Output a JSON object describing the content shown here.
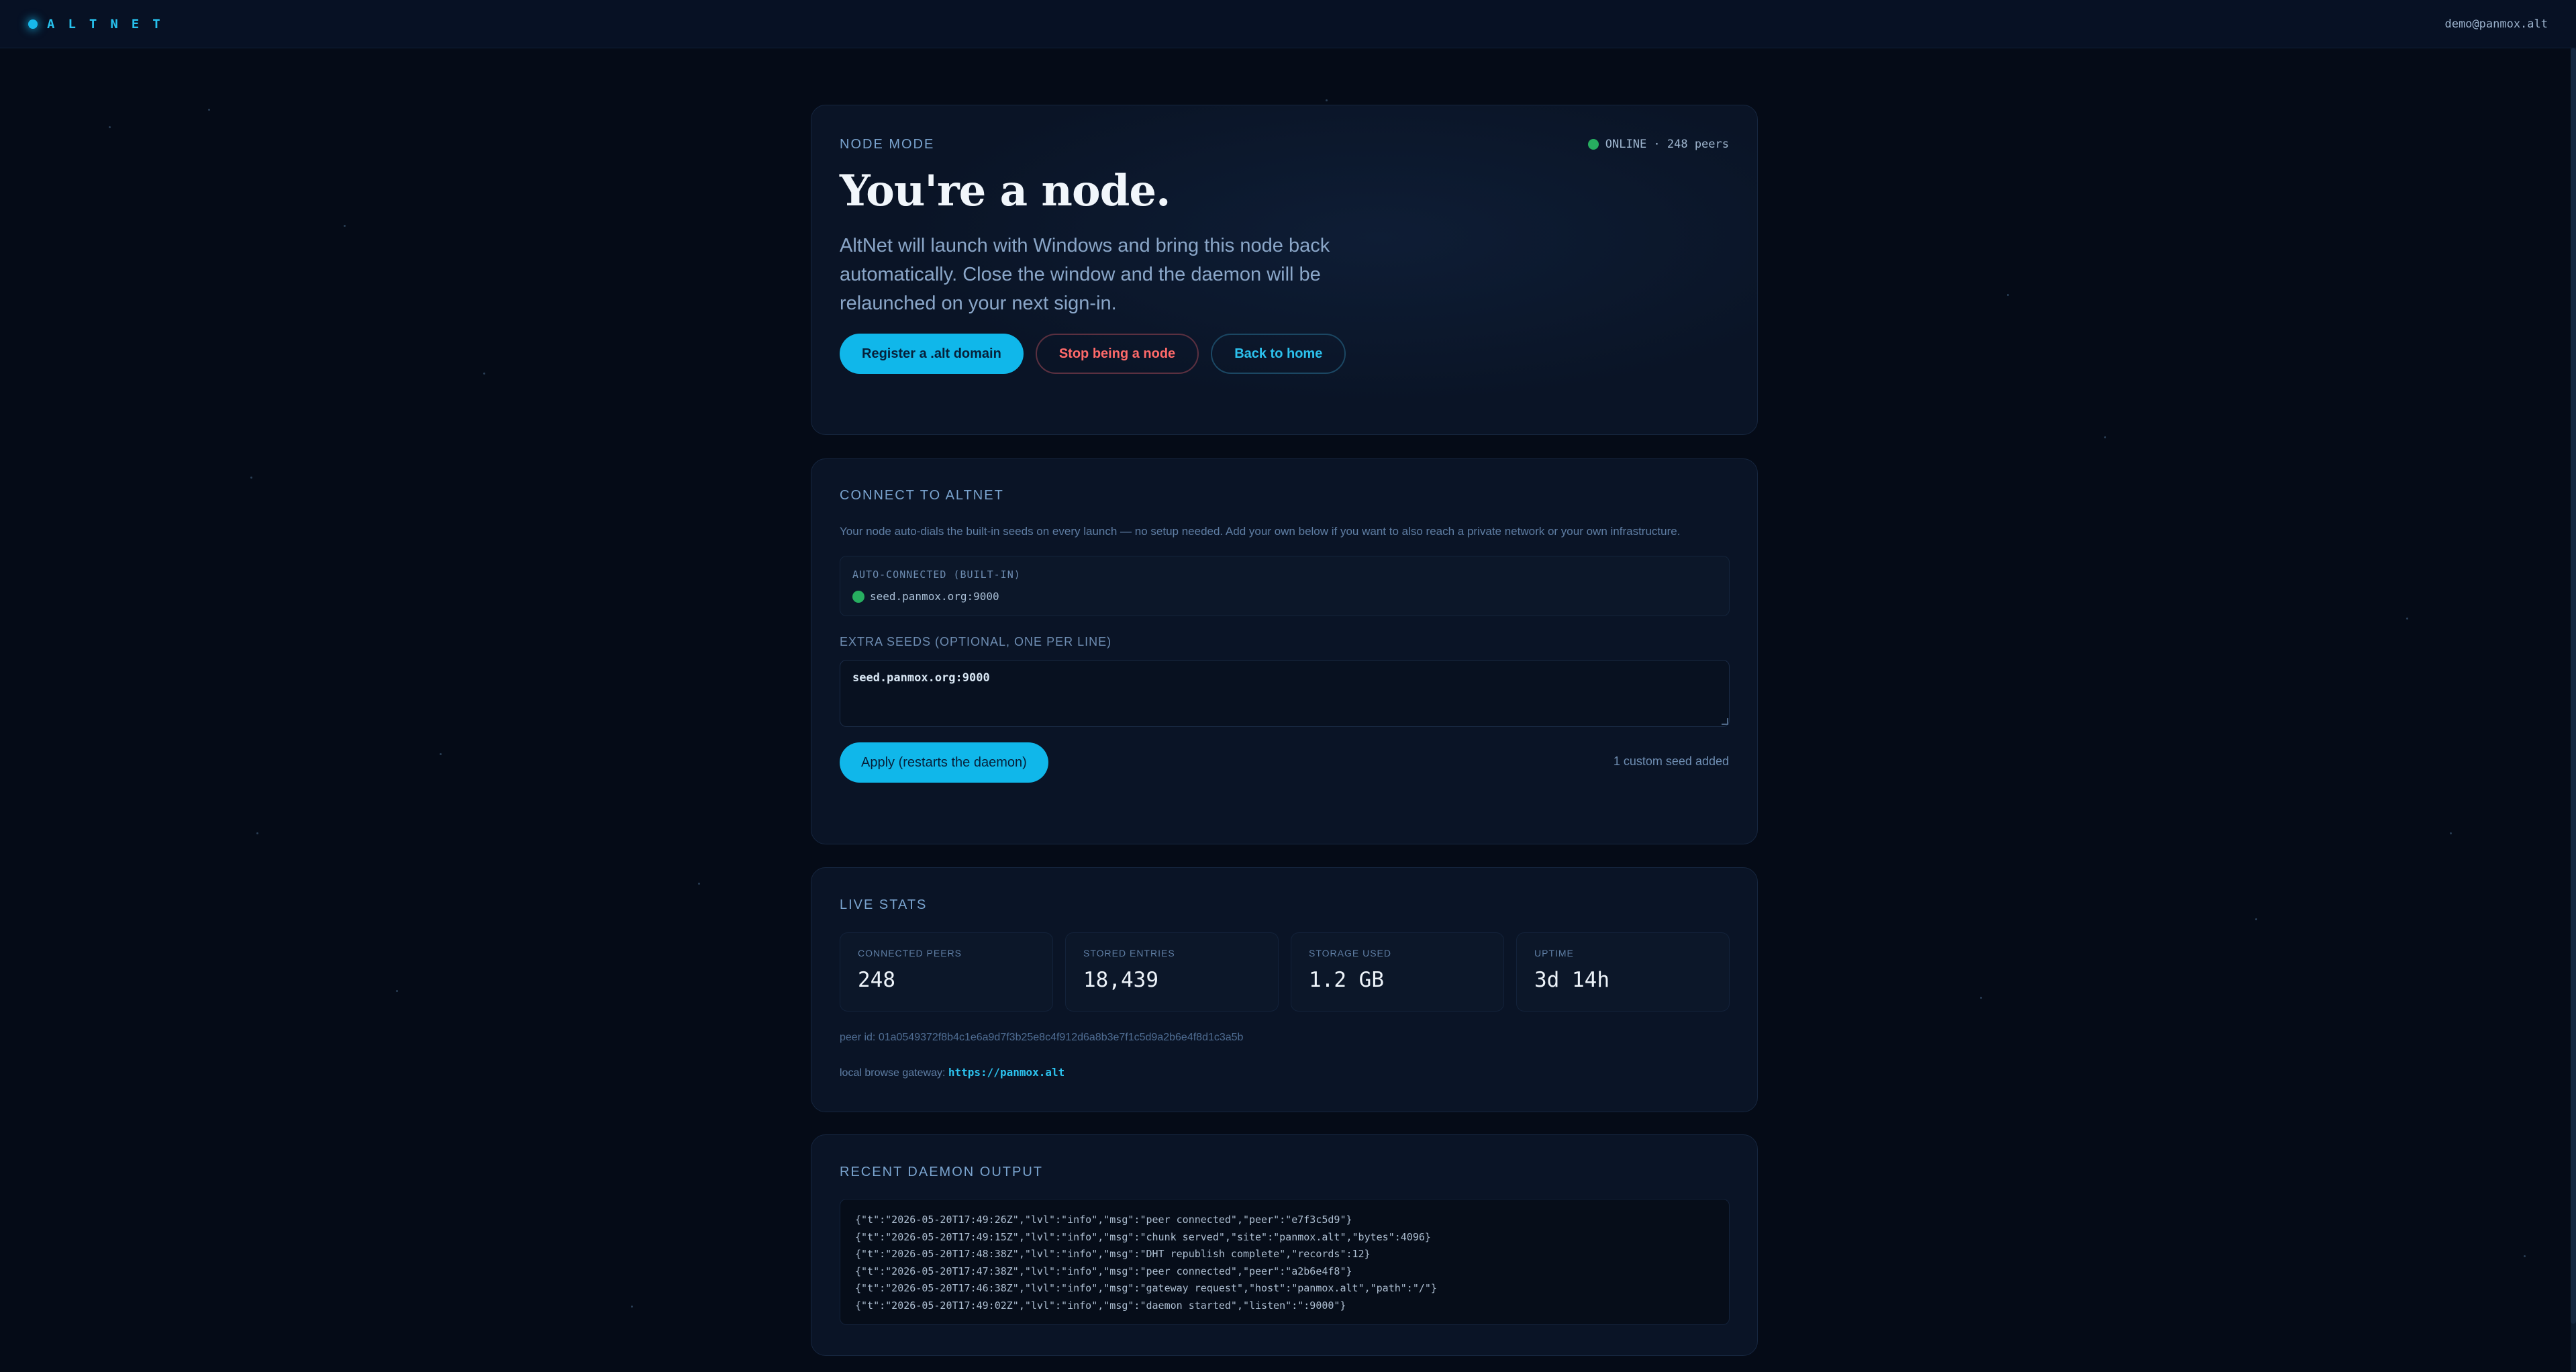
{
  "topbar": {
    "brand": "ALTNET",
    "user": "demo@panmox.alt"
  },
  "node": {
    "section_title": "NODE MODE",
    "status_text": "ONLINE · 248 peers",
    "headline": "You're a node.",
    "description": "AltNet will launch with Windows and bring this node back automatically. Close the window and the daemon will be relaunched on your next sign-in.",
    "buttons": {
      "register": "Register a .alt domain",
      "stop": "Stop being a node",
      "home": "Back to home"
    }
  },
  "connect": {
    "section_title": "CONNECT TO ALTNET",
    "help": "Your node auto-dials the built-in seeds on every launch — no setup needed. Add your own below if you want to also reach a private network or your own infrastructure.",
    "auto_label": "AUTO-CONNECTED (BUILT-IN)",
    "auto_seed": "seed.panmox.org:9000",
    "extra_label": "EXTRA SEEDS (OPTIONAL, ONE PER LINE)",
    "extra_value": "seed.panmox.org:9000",
    "apply_label": "Apply (restarts the daemon)",
    "seed_count": "1 custom seed added"
  },
  "stats": {
    "section_title": "LIVE STATS",
    "items": [
      {
        "label": "CONNECTED PEERS",
        "value": "248"
      },
      {
        "label": "STORED ENTRIES",
        "value": "18,439"
      },
      {
        "label": "STORAGE USED",
        "value": "1.2 GB"
      },
      {
        "label": "UPTIME",
        "value": "3d 14h"
      }
    ],
    "peer_id": "peer id: 01a0549372f8b4c1e6a9d7f3b25e8c4f912d6a8b3e7f1c5d9a2b6e4f8d1c3a5b",
    "gateway_prefix": "local browse gateway:",
    "gateway_link": "https://panmox.alt"
  },
  "log": {
    "section_title": "RECENT DAEMON OUTPUT",
    "lines": [
      "{\"t\":\"2026-05-20T17:49:26Z\",\"lvl\":\"info\",\"msg\":\"peer connected\",\"peer\":\"e7f3c5d9\"}",
      "{\"t\":\"2026-05-20T17:49:15Z\",\"lvl\":\"info\",\"msg\":\"chunk served\",\"site\":\"panmox.alt\",\"bytes\":4096}",
      "{\"t\":\"2026-05-20T17:48:38Z\",\"lvl\":\"info\",\"msg\":\"DHT republish complete\",\"records\":12}",
      "{\"t\":\"2026-05-20T17:47:38Z\",\"lvl\":\"info\",\"msg\":\"peer connected\",\"peer\":\"a2b6e4f8\"}",
      "{\"t\":\"2026-05-20T17:46:38Z\",\"lvl\":\"info\",\"msg\":\"gateway request\",\"host\":\"panmox.alt\",\"path\":\"/\"}",
      "{\"t\":\"2026-05-20T17:49:02Z\",\"lvl\":\"info\",\"msg\":\"daemon started\",\"listen\":\":9000\"}"
    ]
  },
  "colors": {
    "accent": "#10b7ea",
    "danger": "#ff6a6a",
    "online": "#27ae60",
    "background": "#050b17"
  }
}
